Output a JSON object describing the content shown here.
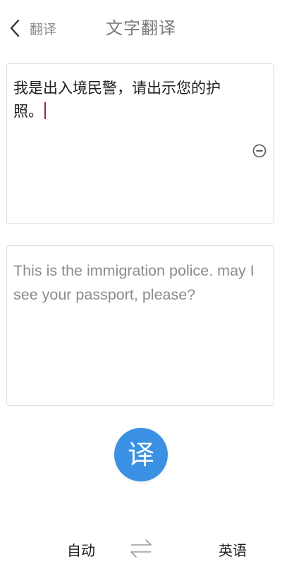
{
  "header": {
    "back_icon": "chevron-left-icon",
    "back_label": "翻译",
    "title": "文字翻译"
  },
  "source": {
    "text": "我是出入境民警，请出示您的护照。",
    "clear_icon": "minus-circle-icon",
    "accent_color": "#a0204a"
  },
  "result": {
    "text": "This is the immigration police. may I see your passport, please?"
  },
  "actions": {
    "translate_label": "译",
    "translate_color": "#3a91e4"
  },
  "languages": {
    "from": "自动",
    "swap_icon": "swap-arrows-icon",
    "to": "英语"
  }
}
